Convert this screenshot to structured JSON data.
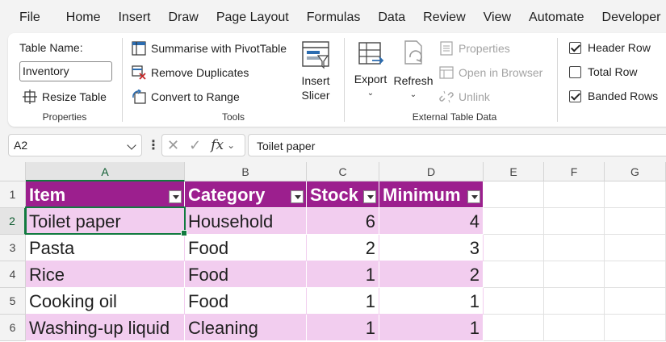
{
  "menu": [
    "File",
    "Home",
    "Insert",
    "Draw",
    "Page Layout",
    "Formulas",
    "Data",
    "Review",
    "View",
    "Automate",
    "Developer"
  ],
  "ribbon": {
    "properties": {
      "table_name_label": "Table Name:",
      "table_name_value": "Inventory",
      "resize_label": "Resize Table",
      "group_label": "Properties"
    },
    "tools": {
      "pivot_label": "Summarise with PivotTable",
      "remove_dup_label": "Remove Duplicates",
      "convert_label": "Convert to Range",
      "slicer_label_1": "Insert",
      "slicer_label_2": "Slicer",
      "group_label": "Tools"
    },
    "external": {
      "export_label": "Export",
      "refresh_label": "Refresh",
      "properties_label": "Properties",
      "open_browser_label": "Open in Browser",
      "unlink_label": "Unlink",
      "group_label": "External Table Data"
    },
    "style_options": {
      "header_row": {
        "label": "Header Row",
        "checked": true
      },
      "total_row": {
        "label": "Total Row",
        "checked": false
      },
      "banded_rows": {
        "label": "Banded Rows",
        "checked": true
      }
    }
  },
  "formula_bar": {
    "name_box": "A2",
    "fx": "fx",
    "formula": "Toilet paper"
  },
  "sheet": {
    "columns": [
      "A",
      "B",
      "C",
      "D",
      "E",
      "F",
      "G"
    ],
    "rows": [
      "1",
      "2",
      "3",
      "4",
      "5",
      "6"
    ],
    "headers": [
      "Item",
      "Category",
      "Stock",
      "Minimum"
    ],
    "data": [
      [
        "Toilet paper",
        "Household",
        "6",
        "4"
      ],
      [
        "Pasta",
        "Food",
        "2",
        "3"
      ],
      [
        "Rice",
        "Food",
        "1",
        "2"
      ],
      [
        "Cooking oil",
        "Food",
        "1",
        "1"
      ],
      [
        "Washing-up liquid",
        "Cleaning",
        "1",
        "1"
      ]
    ],
    "selected_cell": "A2"
  },
  "colors": {
    "table_header": "#9c1f8e",
    "band": "#f2cdef",
    "selection": "#117a3f"
  }
}
